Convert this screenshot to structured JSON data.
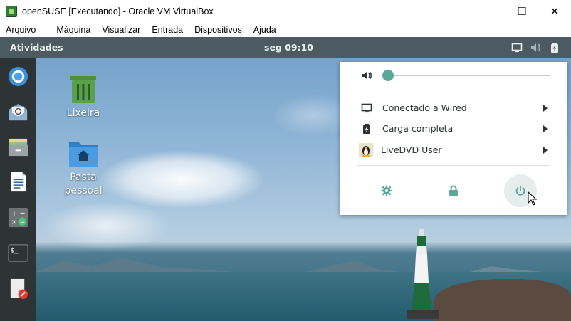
{
  "window": {
    "title": "openSUSE [Executando] - Oracle VM VirtualBox",
    "controls": {
      "minimize": "—",
      "maximize": "☐",
      "close": "✕"
    }
  },
  "menubar": {
    "items": [
      "Arquivo",
      "Máquina",
      "Visualizar",
      "Entrada",
      "Dispositivos",
      "Ajuda"
    ]
  },
  "topbar": {
    "activities": "Atividades",
    "clock": "seg 09:10",
    "icons": [
      "display-icon",
      "volume-icon",
      "battery-icon"
    ]
  },
  "dock": {
    "items": [
      "chromium-icon",
      "mail-icon",
      "files-icon",
      "document-icon",
      "calculator-icon",
      "terminal-icon",
      "text-editor-icon"
    ]
  },
  "desktop": {
    "icons": [
      {
        "label": "Lixeira",
        "icon": "trash-icon"
      },
      {
        "label": "Pasta pessoal",
        "icon": "home-folder-icon"
      }
    ]
  },
  "system_menu": {
    "volume": {
      "icon": "volume-icon",
      "level": 0
    },
    "items": [
      {
        "label": "Conectado a Wired",
        "icon": "network-wired-icon"
      },
      {
        "label": "Carga completa",
        "icon": "battery-icon"
      },
      {
        "label": "LiveDVD User",
        "icon": "user-avatar-icon"
      }
    ],
    "actions": [
      "settings-icon",
      "lock-icon",
      "power-icon"
    ],
    "accent_color": "#5aa89a"
  }
}
